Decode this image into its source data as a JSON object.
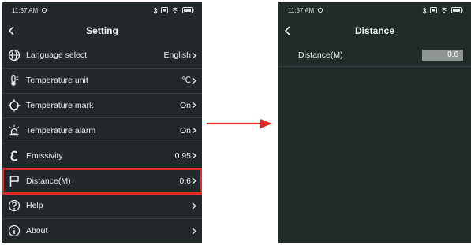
{
  "left_screen": {
    "status_time": "11:37 AM",
    "title": "Setting",
    "items": [
      {
        "label": "Language select",
        "value": "English"
      },
      {
        "label": "Temperature unit",
        "value": "℃"
      },
      {
        "label": "Temperature mark",
        "value": "On"
      },
      {
        "label": "Temperature alarm",
        "value": "On"
      },
      {
        "label": "Emissivity",
        "value": "0.95"
      },
      {
        "label": "Distance(M)",
        "value": "0.6"
      },
      {
        "label": "Help",
        "value": ""
      },
      {
        "label": "About",
        "value": ""
      }
    ]
  },
  "right_screen": {
    "status_time": "11:57 AM",
    "title": "Distance",
    "distance_label": "Distance(M)",
    "distance_value": "0.6"
  },
  "colors": {
    "screen_bg": "#23292a",
    "highlight": "#e02a2a",
    "arrow": "#e02a2a",
    "input_bg": "#8f9494"
  },
  "icons": {
    "language": "globe-icon",
    "temp_unit": "thermometer-icon",
    "temp_mark": "crosshair-icon",
    "temp_alarm": "alarm-icon",
    "emissivity": "epsilon-icon",
    "distance": "flag-icon",
    "help": "question-icon",
    "about": "info-icon"
  }
}
